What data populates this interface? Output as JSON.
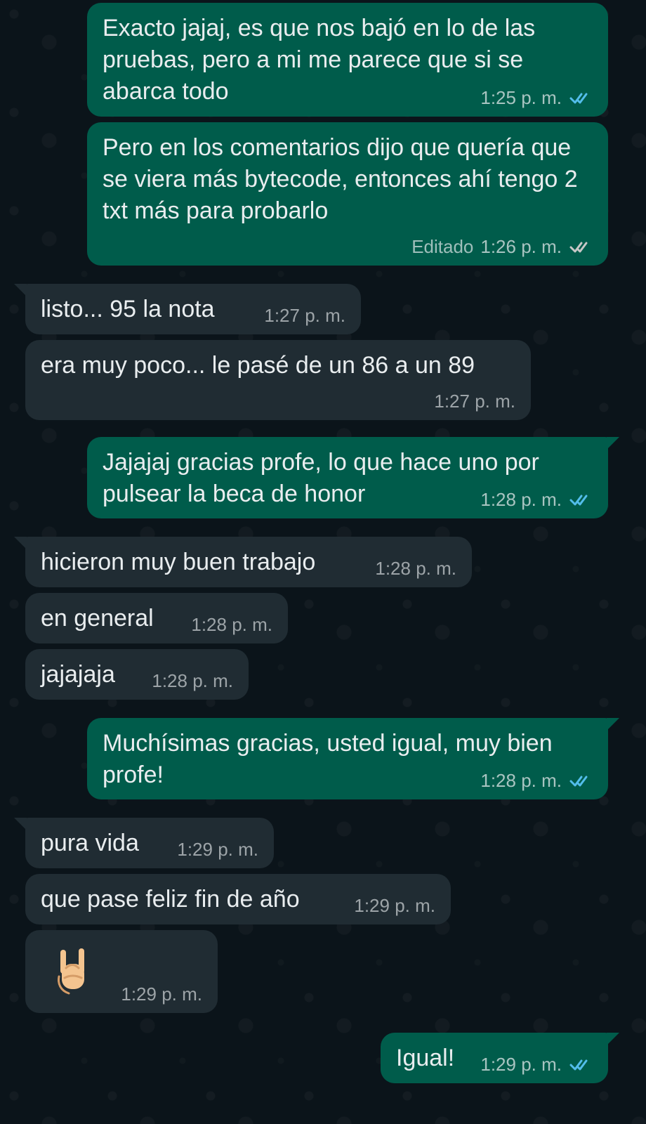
{
  "chat": {
    "messages": [
      {
        "text": "Exacto jajaj, es que nos bajó en lo de las pruebas, pero a mi me parece que si se abarca todo",
        "time": "1:25 p. m.",
        "direction": "outgoing",
        "status": "read"
      },
      {
        "text": "Pero en los comentarios dijo que quería que se viera más bytecode, entonces ahí tengo 2 txt más para probarlo",
        "edited_label": "Editado",
        "time": "1:26 p. m.",
        "direction": "outgoing",
        "status": "delivered"
      },
      {
        "text": "listo... 95 la nota",
        "time": "1:27 p. m.",
        "direction": "incoming"
      },
      {
        "text": "era muy poco... le pasé de un 86 a un 89",
        "time": "1:27 p. m.",
        "direction": "incoming"
      },
      {
        "text": "Jajajaj gracias profe, lo que hace uno por pulsear la beca de honor",
        "time": "1:28 p. m.",
        "direction": "outgoing",
        "status": "read"
      },
      {
        "text": "hicieron muy buen trabajo",
        "time": "1:28 p. m.",
        "direction": "incoming"
      },
      {
        "text": "en general",
        "time": "1:28 p. m.",
        "direction": "incoming"
      },
      {
        "text": "jajajaja",
        "time": "1:28 p. m.",
        "direction": "incoming"
      },
      {
        "text": "Muchísimas gracias, usted igual, muy bien profe!",
        "time": "1:28 p. m.",
        "direction": "outgoing",
        "status": "read"
      },
      {
        "text": "pura vida",
        "time": "1:29 p. m.",
        "direction": "incoming"
      },
      {
        "text": "que pase feliz fin de año",
        "time": "1:29 p. m.",
        "direction": "incoming"
      },
      {
        "emoji": "sign-of-the-horns-icon",
        "time": "1:29 p. m.",
        "direction": "incoming"
      },
      {
        "text": "Igual!",
        "time": "1:29 p. m.",
        "direction": "outgoing",
        "status": "read"
      }
    ]
  },
  "colors": {
    "background": "#0b141a",
    "outgoing_bubble": "#005c4b",
    "incoming_bubble": "#202c33",
    "text": "#e9edef",
    "read_check": "#53bdeb",
    "delivered_check": "#c7c7c7"
  }
}
